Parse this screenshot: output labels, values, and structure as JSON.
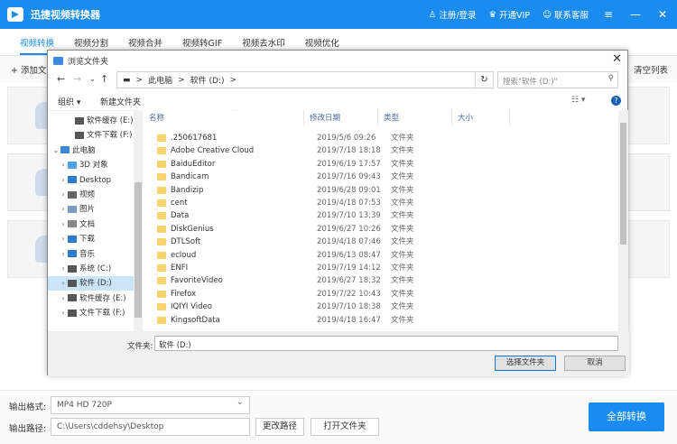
{
  "app": {
    "title": "迅捷视频转换器",
    "register": "注册/登录",
    "vip": "开通VIP",
    "service": "联系客服"
  },
  "tabs": [
    "视频转换",
    "视频分割",
    "视频合并",
    "视频转GIF",
    "视频去水印",
    "视频优化"
  ],
  "toolbar": {
    "add_file": "+ 添加文",
    "clear_list": "清空列表"
  },
  "bottom": {
    "format_label": "输出格式:",
    "format_value": "MP4  HD 720P",
    "path_label": "输出路径:",
    "path_value": "C:\\Users\\cddehsy\\Desktop",
    "change_path": "更改路径",
    "open_folder": "打开文件夹",
    "convert_all": "全部转换"
  },
  "dialog": {
    "title": "浏览文件夹",
    "address": {
      "pc": "此电脑",
      "sep": ">",
      "drive": "软件 (D:)"
    },
    "search_placeholder": "搜索\"软件 (D:)\"",
    "organize": "组织 ▾",
    "new_folder": "新建文件夹",
    "tree": [
      {
        "label": "软件缓存 (E:)",
        "icon": "drive-icon",
        "indent": 2,
        "exp": ""
      },
      {
        "label": "文件下载 (F:)",
        "icon": "drive-icon",
        "indent": 2,
        "exp": ""
      },
      {
        "label": "此电脑",
        "icon": "pc-icon",
        "indent": 0,
        "exp": "⌄"
      },
      {
        "label": "3D 对象",
        "icon": "3d-icon",
        "indent": 1,
        "exp": "›"
      },
      {
        "label": "Desktop",
        "icon": "desktop-icon",
        "indent": 1,
        "exp": "›"
      },
      {
        "label": "视频",
        "icon": "video-icon",
        "indent": 1,
        "exp": "›"
      },
      {
        "label": "图片",
        "icon": "picture-icon",
        "indent": 1,
        "exp": "›"
      },
      {
        "label": "文档",
        "icon": "document-icon",
        "indent": 1,
        "exp": "›"
      },
      {
        "label": "下载",
        "icon": "download-icon",
        "indent": 1,
        "exp": "›"
      },
      {
        "label": "音乐",
        "icon": "music-icon",
        "indent": 1,
        "exp": "›"
      },
      {
        "label": "系统 (C:)",
        "icon": "drive-icon",
        "indent": 1,
        "exp": "›"
      },
      {
        "label": "软件 (D:)",
        "icon": "drive-icon",
        "indent": 1,
        "exp": "›",
        "selected": true
      },
      {
        "label": "软件缓存 (E:)",
        "icon": "drive-icon",
        "indent": 1,
        "exp": "›"
      },
      {
        "label": "文件下载 (F:)",
        "icon": "drive-icon",
        "indent": 1,
        "exp": "›"
      }
    ],
    "columns": {
      "name": "名称",
      "date": "修改日期",
      "type": "类型",
      "size": "大小"
    },
    "files": [
      {
        "name": ".250617681",
        "date": "2019/5/6 09:26",
        "type": "文件夹"
      },
      {
        "name": "Adobe Creative Cloud",
        "date": "2019/7/18 18:18",
        "type": "文件夹"
      },
      {
        "name": "BaiduEditor",
        "date": "2019/6/19 17:57",
        "type": "文件夹"
      },
      {
        "name": "Bandicam",
        "date": "2019/7/16 09:43",
        "type": "文件夹"
      },
      {
        "name": "Bandizip",
        "date": "2019/6/28 09:01",
        "type": "文件夹"
      },
      {
        "name": "cent",
        "date": "2019/4/18 07:53",
        "type": "文件夹"
      },
      {
        "name": "Data",
        "date": "2019/7/10 13:39",
        "type": "文件夹"
      },
      {
        "name": "DiskGenius",
        "date": "2019/6/27 10:26",
        "type": "文件夹"
      },
      {
        "name": "DTLSoft",
        "date": "2019/4/18 07:46",
        "type": "文件夹"
      },
      {
        "name": "ecloud",
        "date": "2019/6/13 08:47",
        "type": "文件夹"
      },
      {
        "name": "ENFI",
        "date": "2019/7/19 14:12",
        "type": "文件夹"
      },
      {
        "name": "FavoriteVideo",
        "date": "2019/6/27 18:32",
        "type": "文件夹"
      },
      {
        "name": "Firefox",
        "date": "2019/7/22 10:43",
        "type": "文件夹"
      },
      {
        "name": "IQIYI Video",
        "date": "2019/7/10 18:38",
        "type": "文件夹"
      },
      {
        "name": "KingsoftData",
        "date": "2019/4/18 16:47",
        "type": "文件夹"
      }
    ],
    "folder_label": "文件夹:",
    "folder_value": "软件 (D:)",
    "select_button": "选择文件夹",
    "cancel_button": "取消"
  }
}
